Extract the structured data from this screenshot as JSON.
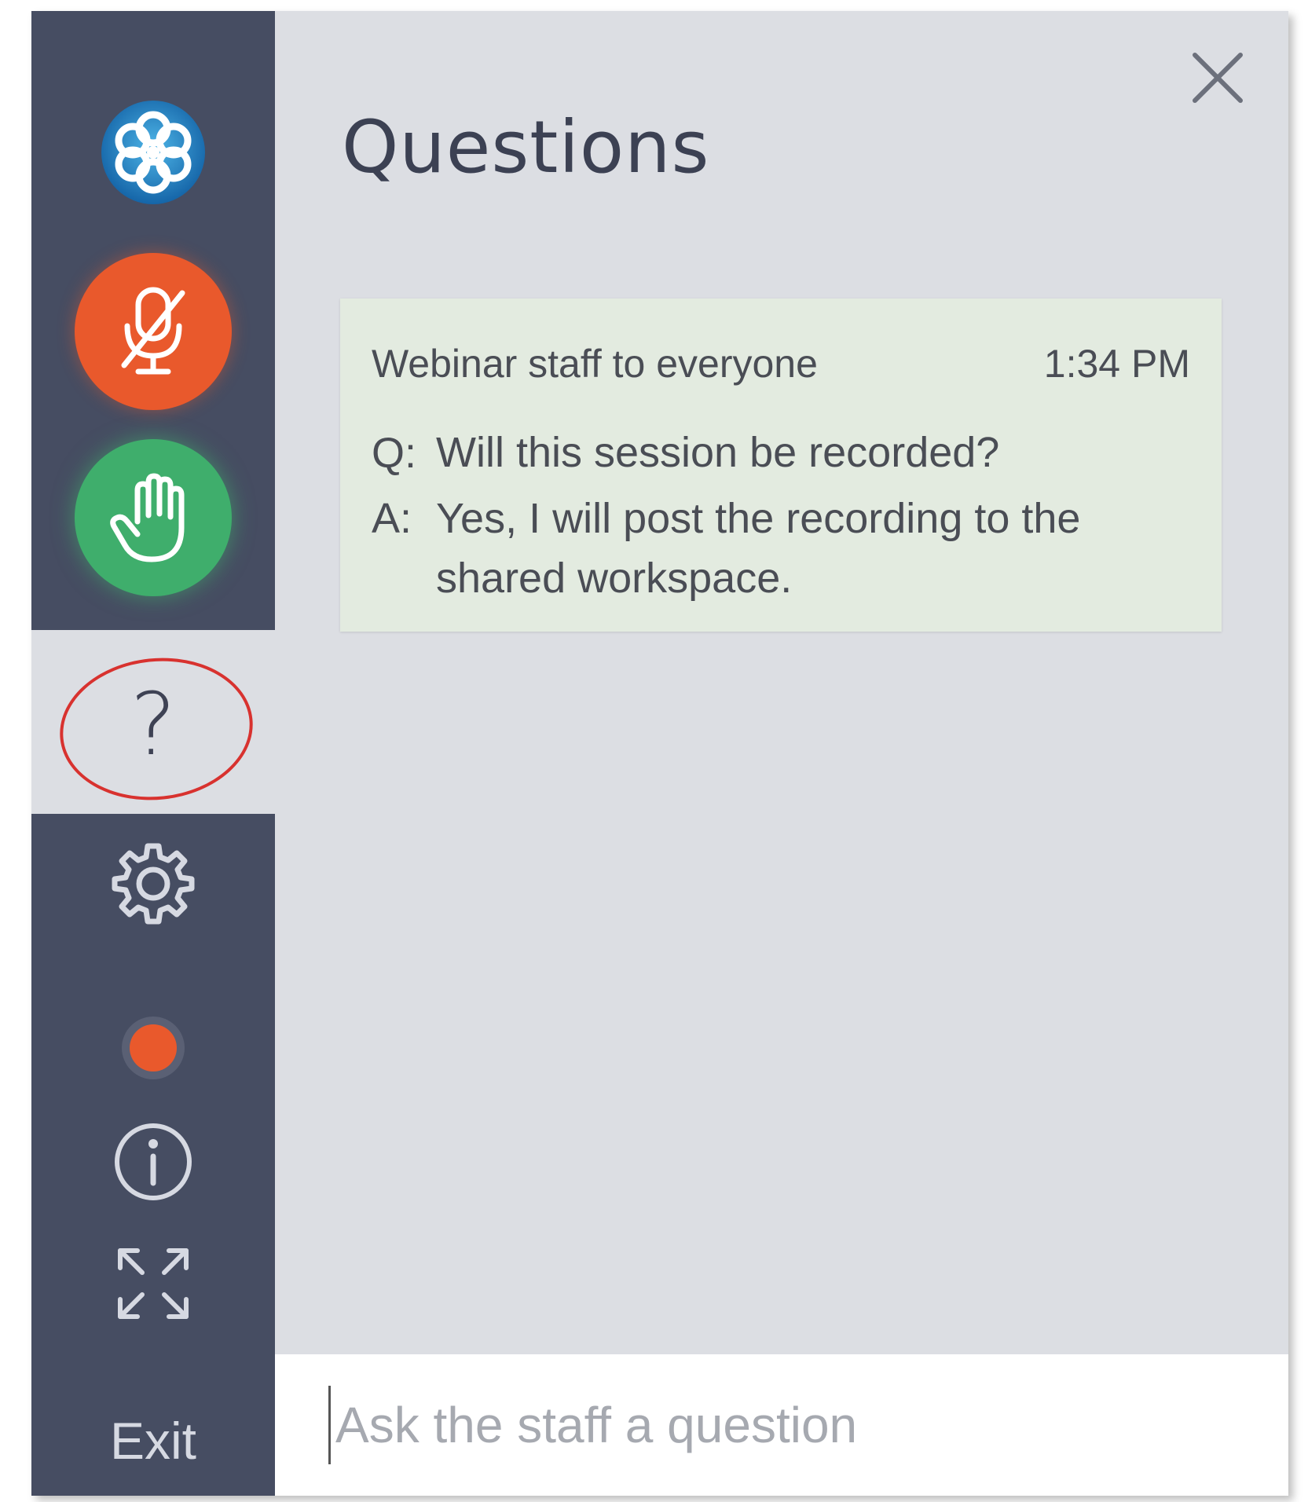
{
  "sidebar": {
    "items": [
      {
        "name": "logo",
        "icon": "flower-logo-icon"
      },
      {
        "name": "mute",
        "icon": "mic-muted-icon",
        "color": "#e9592c"
      },
      {
        "name": "raise-hand",
        "icon": "hand-icon",
        "color": "#3fae6c"
      },
      {
        "name": "questions",
        "icon": "question-mark-icon",
        "glyph": "?",
        "active": true
      },
      {
        "name": "settings",
        "icon": "gear-icon"
      },
      {
        "name": "recording",
        "icon": "record-dot-icon",
        "color": "#e9592c"
      },
      {
        "name": "info",
        "icon": "info-icon"
      },
      {
        "name": "fullscreen",
        "icon": "expand-icon"
      }
    ],
    "exit_label": "Exit"
  },
  "panel": {
    "title": "Questions",
    "close_icon": "close-icon"
  },
  "messages": [
    {
      "sender": "Webinar staff to everyone",
      "time": "1:34 PM",
      "q_prefix": "Q:",
      "question": "Will this session be recorded?",
      "a_prefix": "A:",
      "answer": "Yes, I will post the recording to the shared workspace."
    }
  ],
  "input": {
    "placeholder": "Ask the staff a question",
    "value": ""
  },
  "colors": {
    "sidebar": "#464d62",
    "panel": "#dcdee3",
    "card": "#e3ebe0",
    "annotation_ring": "#d8322f"
  }
}
